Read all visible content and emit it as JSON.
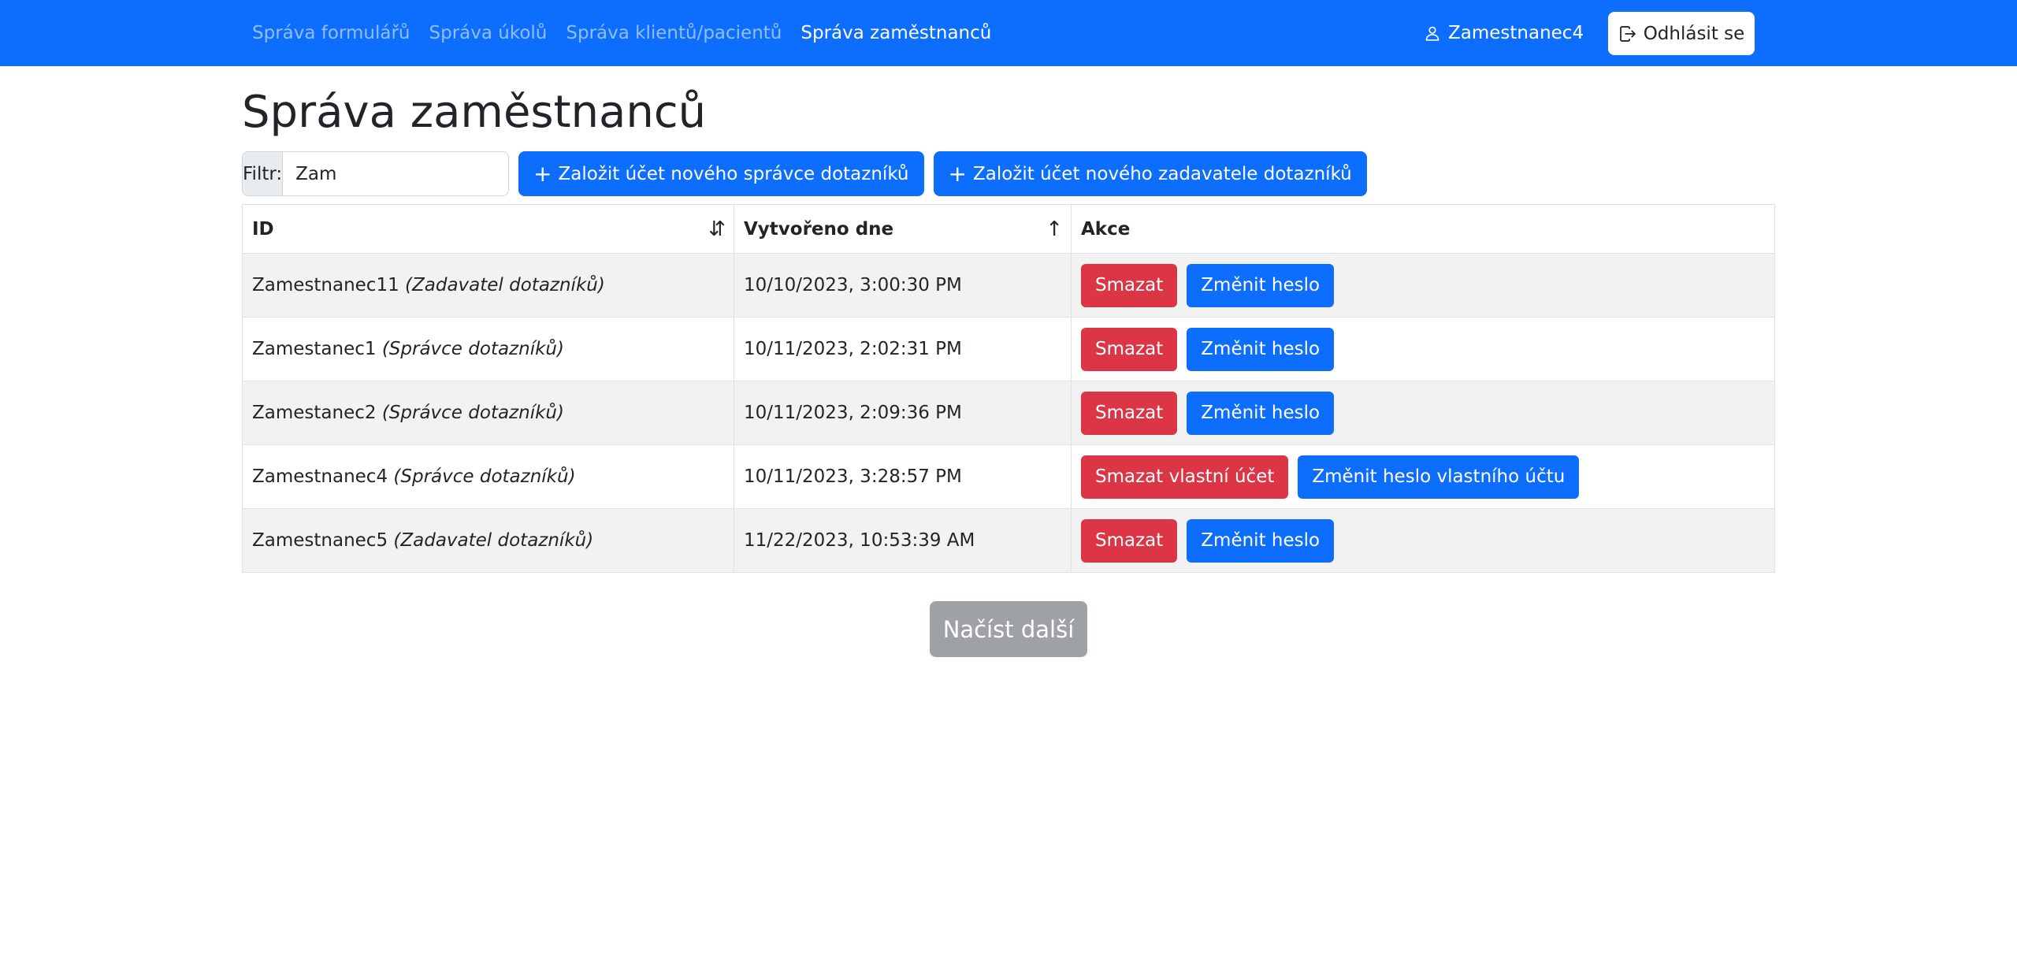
{
  "nav": {
    "links": [
      {
        "label": "Správa formulářů"
      },
      {
        "label": "Správa úkolů"
      },
      {
        "label": "Správa klientů/pacientů"
      },
      {
        "label": "Správa zaměstnanců"
      }
    ],
    "user_name": "Zamestnanec4",
    "user_icon": "person-icon",
    "logout_label": "Odhlásit se",
    "logout_icon": "logout-icon"
  },
  "page": {
    "title": "Správa zaměstnanců"
  },
  "toolbar": {
    "filter_label": "Filtr:",
    "filter_value": "Zam",
    "create_admin_label": "Založit účet nového správce dotazníků",
    "create_submitter_label": "Založit účet nového zadavatele dotazníků"
  },
  "table": {
    "headers": {
      "id": "ID",
      "created": "Vytvořeno dne",
      "actions": "Akce"
    },
    "rows": [
      {
        "name": "Zamestnanec11",
        "role": "(Zadavatel dotazníků)",
        "created": "10/10/2023, 3:00:30 PM",
        "delete_label": "Smazat",
        "change_label": "Změnit heslo"
      },
      {
        "name": "Zamestanec1",
        "role": "(Správce dotazníků)",
        "created": "10/11/2023, 2:02:31 PM",
        "delete_label": "Smazat",
        "change_label": "Změnit heslo"
      },
      {
        "name": "Zamestanec2",
        "role": "(Správce dotazníků)",
        "created": "10/11/2023, 2:09:36 PM",
        "delete_label": "Smazat",
        "change_label": "Změnit heslo"
      },
      {
        "name": "Zamestnanec4",
        "role": "(Správce dotazníků)",
        "created": "10/11/2023, 3:28:57 PM",
        "delete_label": "Smazat vlastní účet",
        "change_label": "Změnit heslo vlastního účtu"
      },
      {
        "name": "Zamestnanec5",
        "role": "(Zadavatel dotazníků)",
        "created": "11/22/2023, 10:53:39 AM",
        "delete_label": "Smazat",
        "change_label": "Změnit heslo"
      }
    ]
  },
  "load_more_label": "Načíst další",
  "colors": {
    "primary": "#0d6efd",
    "danger": "#dc3545",
    "secondary": "#9ea2a7",
    "stripe": "#f2f2f2"
  }
}
